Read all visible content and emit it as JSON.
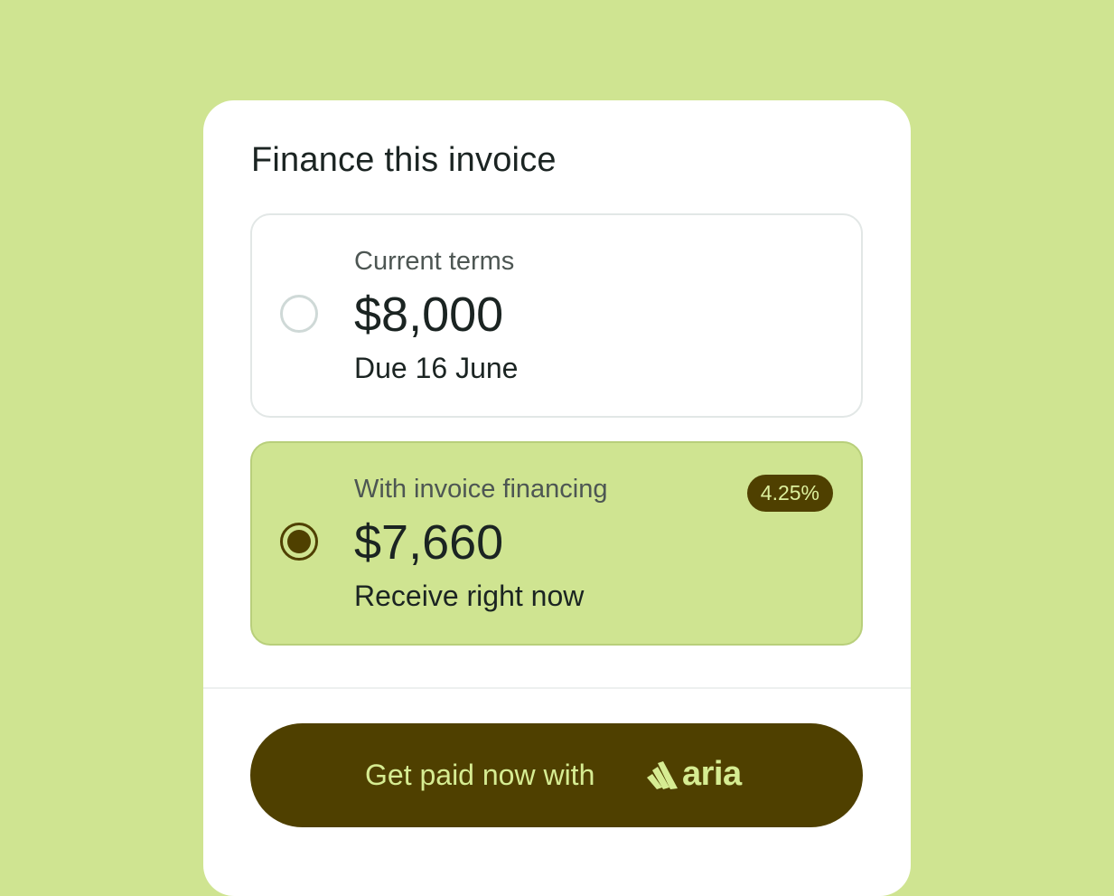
{
  "colors": {
    "page_background": "#cfe491",
    "card_background": "#ffffff",
    "accent_dark": "#4f4000",
    "accent_light": "#d6ec92",
    "selected_option_background": "#cfe491"
  },
  "card": {
    "title": "Finance this invoice"
  },
  "options": [
    {
      "label": "Current terms",
      "amount": "$8,000",
      "subtext": "Due 16 June",
      "selected": false
    },
    {
      "label": "With invoice financing",
      "amount": "$7,660",
      "subtext": "Receive right now",
      "selected": true,
      "badge": "4.25%"
    }
  ],
  "cta": {
    "label": "Get paid now with",
    "brand_name": "aria",
    "brand_icon": "aria-logo-icon"
  }
}
